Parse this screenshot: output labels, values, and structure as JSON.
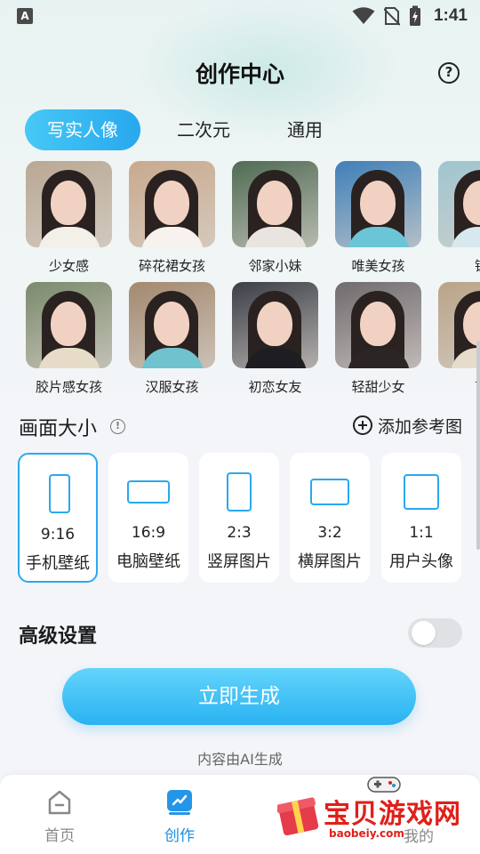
{
  "status_bar": {
    "app_badge": "A",
    "time": "1:41"
  },
  "header": {
    "title": "创作中心",
    "help_glyph": "?"
  },
  "tabs": [
    {
      "label": "写实人像",
      "active": true
    },
    {
      "label": "二次元",
      "active": false
    },
    {
      "label": "通用",
      "active": false
    }
  ],
  "styles": [
    {
      "label": "少女感",
      "bg": "#b9a893",
      "body": "#f3efe9"
    },
    {
      "label": "碎花裙女孩",
      "bg": "#c9a98c",
      "body": "#f7f2ee"
    },
    {
      "label": "邻家小妹",
      "bg": "#4f6b53",
      "body": "#e9e4df"
    },
    {
      "label": "唯美女孩",
      "bg": "#3f7fb8",
      "body": "#6cc5d6"
    },
    {
      "label": "镜",
      "bg": "#9fc5cf",
      "body": "#d8e8ef"
    },
    {
      "label": "胶片感女孩",
      "bg": "#7b8a6c",
      "body": "#e7dcc8"
    },
    {
      "label": "汉服女孩",
      "bg": "#a3896f",
      "body": "#6fc3ce"
    },
    {
      "label": "初恋女友",
      "bg": "#3b3e46",
      "body": "#1e1e22"
    },
    {
      "label": "轻甜少女",
      "bg": "#6f6b6e",
      "body": "#2b2526"
    },
    {
      "label": "苗",
      "bg": "#b9a489",
      "body": "#e7dccc"
    }
  ],
  "canvas_size": {
    "title": "画面大小",
    "info_glyph": "!",
    "add_reference_label": "添加参考图",
    "options": [
      {
        "ratio": "9:16",
        "name": "手机壁纸",
        "selected": true
      },
      {
        "ratio": "16:9",
        "name": "电脑壁纸",
        "selected": false
      },
      {
        "ratio": "2:3",
        "name": "竖屏图片",
        "selected": false
      },
      {
        "ratio": "3:2",
        "name": "横屏图片",
        "selected": false
      },
      {
        "ratio": "1:1",
        "name": "用户头像",
        "selected": false
      }
    ]
  },
  "advanced": {
    "title": "高级设置",
    "enabled": false
  },
  "generate_button": "立即生成",
  "ai_note": "内容由AI生成",
  "bottom_nav": [
    {
      "label": "首页",
      "icon": "home-icon",
      "active": false
    },
    {
      "label": "创作",
      "icon": "create-icon",
      "active": true
    }
  ],
  "watermark": {
    "text": "宝贝游戏网",
    "url": "baobeiy.com",
    "partial_label": "我的"
  },
  "colors": {
    "accent": "#29a8ee",
    "tab_active_start": "#47c8f5",
    "button": "#2ab2f2",
    "watermark": "#e0201a"
  }
}
